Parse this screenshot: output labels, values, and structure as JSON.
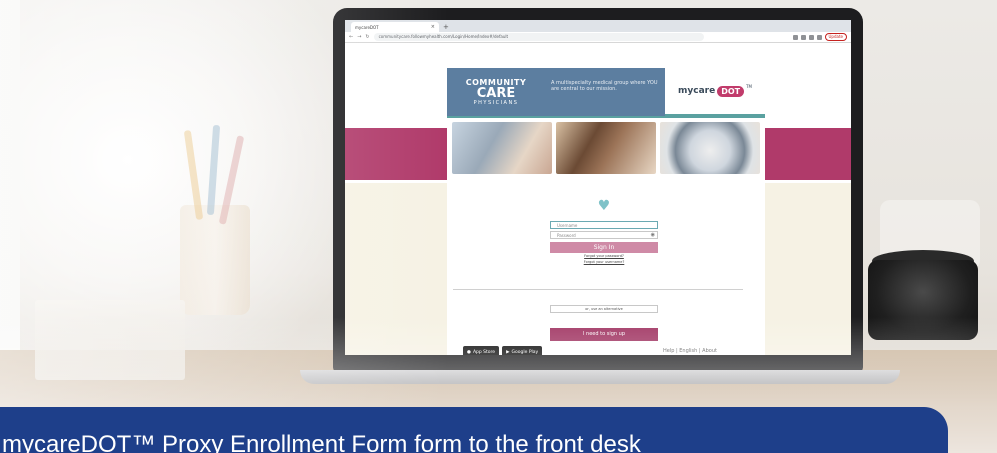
{
  "browser": {
    "tab_title": "mycareDOT",
    "new_tab": "+",
    "url": "communitycare.followmyhealth.com/Login/Home/Index#/default",
    "update_label": "Update"
  },
  "header": {
    "brand_line1": "COMMUNITY",
    "brand_line2": "CARE",
    "brand_line3": "PHYSICIANS",
    "tagline": "A multispecialty medical group where YOU are central to our mission.",
    "product_name": "mycare",
    "product_badge": "DOT",
    "product_tm": "TM"
  },
  "login": {
    "username_placeholder": "Username",
    "password_placeholder": "Password",
    "signin_label": "Sign In",
    "forgot_password": "Forgot your password?",
    "forgot_username": "Forgot your username?",
    "alternative_label": "or, use an alternative",
    "signup_label": "I need to sign up"
  },
  "stores": {
    "app_store": "App Store",
    "google_play": "Google Play"
  },
  "footer": {
    "links": "Help | English | About"
  },
  "caption": {
    "text": "l mycareDOT™ Proxy Enrollment Form form to the front desk"
  },
  "colors": {
    "caption_bg": "#1e3f8a",
    "brand_blue": "#5c7ea0",
    "accent_pink": "#b03a6a",
    "teal": "#5aa1a0"
  }
}
